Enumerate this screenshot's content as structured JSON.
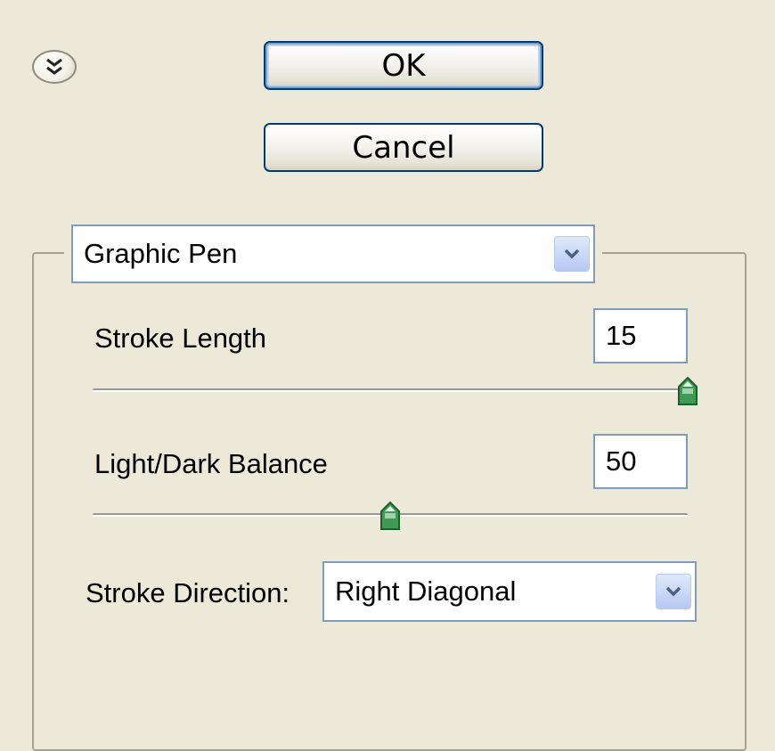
{
  "dialog": {
    "collapse_icon": "double-chevron-down-icon",
    "ok_label": "OK",
    "cancel_label": "Cancel"
  },
  "filter": {
    "selected": "Graphic Pen",
    "dropdown_icon": "chevron-down-icon"
  },
  "settings": {
    "stroke_length": {
      "label": "Stroke Length",
      "value": "15",
      "fraction": 1.0
    },
    "light_dark_balance": {
      "label": "Light/Dark Balance",
      "value": "50",
      "fraction": 0.5
    },
    "stroke_direction": {
      "label": "Stroke Direction:",
      "selected": "Right Diagonal"
    }
  },
  "colors": {
    "background": "#ece9d8",
    "button_border": "#003c74",
    "field_border": "#7f9db9",
    "slider_thumb": "#3f9a55"
  }
}
